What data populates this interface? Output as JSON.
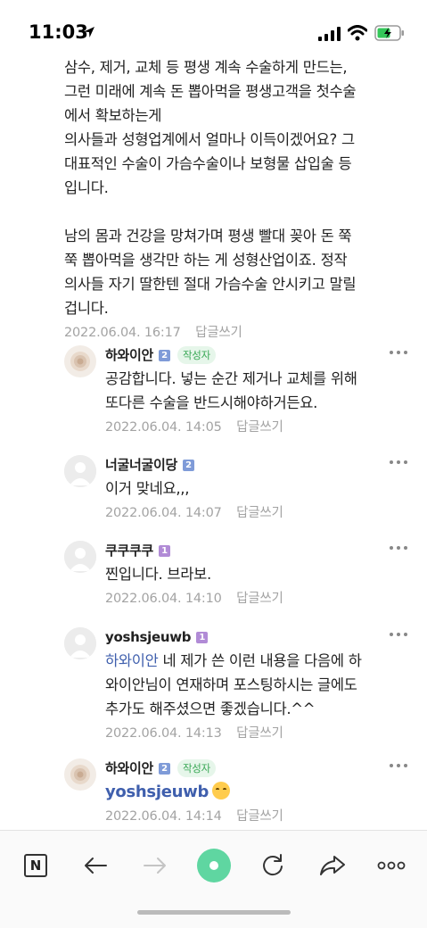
{
  "status_bar": {
    "time": "11:03"
  },
  "post": {
    "text": "삼수, 제거, 교체 등 평생 계속 수술하게 만드는,\n그런 미래에 계속 돈 뽑아먹을 평생고객을 첫수술\n에서 확보하는게\n의사들과 성형업계에서 얼마나 이득이겠어요? 그\n대표적인 수술이 가슴수술이나 보형물 삽입술 등\n입니다.\n\n남의 몸과 건강을 망쳐가며 평생 빨대 꽂아 돈 쭉\n쭉 뽑아먹을 생각만 하는 게 성형산업이죠. 정작\n의사들 자기 딸한텐 절대 가슴수술 안시키고 말릴\n겁니다.",
    "date": "2022.06.04. 16:17",
    "reply_label": "답글쓰기"
  },
  "comments": [
    {
      "name": "하와이안",
      "level": "2",
      "author_badge": "작성자",
      "text": "공감합니다. 넣는 순간 제거나 교체를 위해\n또다른 수술을 반드시해야하거든요.",
      "date": "2022.06.04. 14:05",
      "reply_label": "답글쓰기"
    },
    {
      "name": "너굴너굴이당",
      "level": "2",
      "text": "이거 맞네요,,,",
      "date": "2022.06.04. 14:07",
      "reply_label": "답글쓰기"
    },
    {
      "name": "쿠쿠쿠쿠",
      "level": "1",
      "text": "찐입니다. 브라보.",
      "date": "2022.06.04. 14:10",
      "reply_label": "답글쓰기"
    },
    {
      "name": "yoshsjeuwb",
      "level": "1",
      "mention": "하와이안",
      "text": " 네 제가 쓴 이런 내용을 다음에 하\n와이안님이 연재하며 포스팅하시는 글에도\n추가도 해주셨으면 좋겠습니다.^^",
      "date": "2022.06.04. 14:13",
      "reply_label": "답글쓰기"
    },
    {
      "name": "하와이안",
      "level": "2",
      "author_badge": "작성자",
      "mention": "yoshsjeuwb",
      "emoji": "smiling-face",
      "date": "2022.06.04. 14:14",
      "reply_label": "답글쓰기"
    }
  ],
  "toolbar": {
    "items": [
      "naver-home",
      "back",
      "forward",
      "green-dot",
      "reload",
      "share",
      "more"
    ]
  },
  "colors": {
    "accent_green": "#5fd6a1",
    "mention_blue": "#3f5fad",
    "author_badge_bg": "#e6f6ea"
  }
}
